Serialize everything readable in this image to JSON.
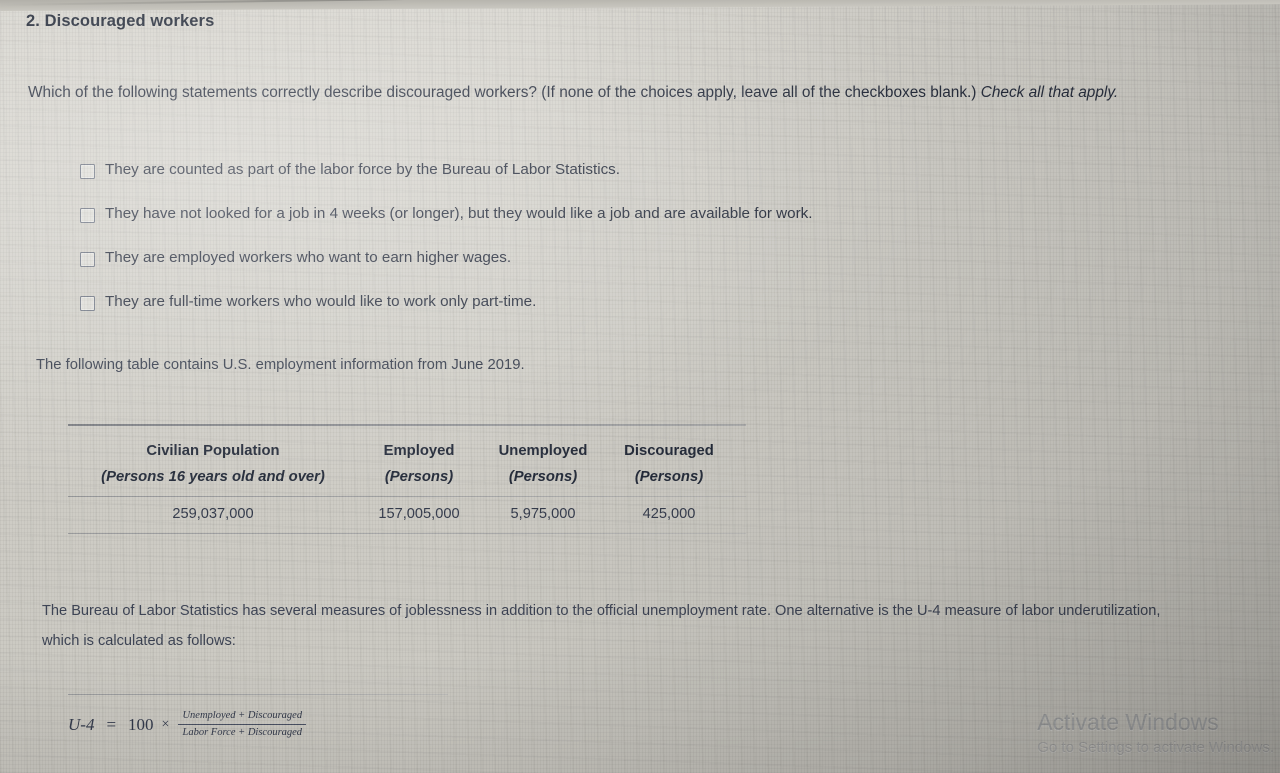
{
  "question": {
    "number_title": "2. Discouraged workers",
    "prompt_main": "Which of the following statements correctly describe discouraged workers? (If none of the choices apply, leave all of the checkboxes blank.) ",
    "prompt_italic": "Check all that apply.",
    "choices": [
      {
        "label": "They are counted as part of the labor force by the Bureau of Labor Statistics.",
        "checked": false
      },
      {
        "label": "They have not looked for a job in 4 weeks (or longer), but they would like a job and are available for work.",
        "checked": false
      },
      {
        "label": "They are employed workers who want to earn higher wages.",
        "checked": false
      },
      {
        "label": "They are full-time workers who would like to work only part-time.",
        "checked": false
      }
    ]
  },
  "table_intro": "The following table contains U.S. employment information from June 2019.",
  "chart_data": {
    "type": "table",
    "title": "U.S. employment information from June 2019",
    "columns": [
      {
        "line1": "Civilian Population",
        "line2": "(Persons 16 years old and over)"
      },
      {
        "line1": "Employed",
        "line2": "(Persons)"
      },
      {
        "line1": "Unemployed",
        "line2": "(Persons)"
      },
      {
        "line1": "Discouraged",
        "line2": "(Persons)"
      }
    ],
    "rows": [
      [
        "259,037,000",
        "157,005,000",
        "5,975,000",
        "425,000"
      ]
    ]
  },
  "bls_paragraph": "The Bureau of Labor Statistics has several measures of joblessness in addition to the official unemployment rate. One alternative is the U-4 measure of labor underutilization, which is calculated as follows:",
  "formula": {
    "lhs": "U-4",
    "equals": "=",
    "coefficient": "100",
    "times": "×",
    "numerator": "Unemployed + Discouraged",
    "denominator": "Labor Force + Discouraged"
  },
  "watermark": {
    "line1": "Activate Windows",
    "line2": "Go to Settings to activate Windows."
  }
}
